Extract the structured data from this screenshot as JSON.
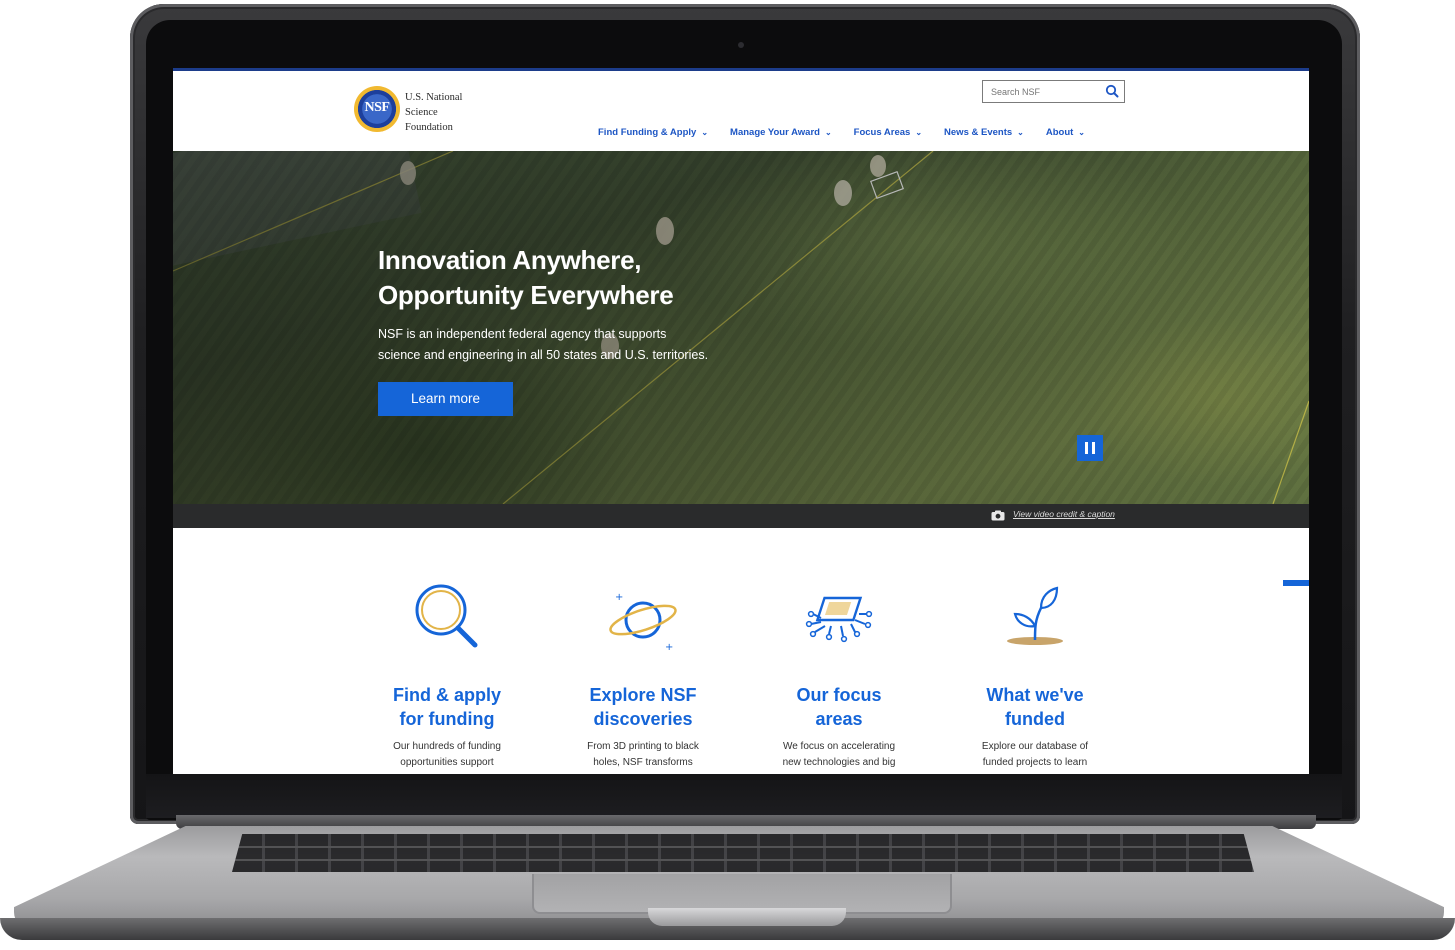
{
  "header": {
    "logo_text_line1": "U.S. National",
    "logo_text_line2": "Science",
    "logo_text_line3": "Foundation",
    "logo_seal_text": "NSF",
    "search_placeholder": "Search NSF"
  },
  "nav": {
    "items": [
      {
        "label": "Find Funding & Apply"
      },
      {
        "label": "Manage Your Award"
      },
      {
        "label": "Focus Areas"
      },
      {
        "label": "News & Events"
      },
      {
        "label": "About"
      }
    ]
  },
  "hero": {
    "title_line1": "Innovation Anywhere,",
    "title_line2": "Opportunity Everywhere",
    "subtitle_line1": "NSF is an independent federal agency that supports",
    "subtitle_line2": "science and engineering in all 50 states and U.S. territories.",
    "cta_label": "Learn more",
    "caption_link": "View video credit & caption"
  },
  "features": [
    {
      "icon": "magnifying-glass-icon",
      "title_line1": "Find & apply",
      "title_line2": "for funding",
      "desc_line1": "Our hundreds of funding",
      "desc_line2": "opportunities support"
    },
    {
      "icon": "planet-icon",
      "title_line1": "Explore NSF",
      "title_line2": "discoveries",
      "desc_line1": "From 3D printing to black",
      "desc_line2": "holes, NSF transforms"
    },
    {
      "icon": "microchip-icon",
      "title_line1": "Our focus",
      "title_line2": "areas",
      "desc_line1": "We focus on accelerating",
      "desc_line2": "new technologies and big"
    },
    {
      "icon": "sprout-icon",
      "title_line1": "What we've",
      "title_line2": "funded",
      "desc_line1": "Explore our database of",
      "desc_line2": "funded projects to learn"
    }
  ],
  "colors": {
    "brand_blue": "#1565d8",
    "nav_blue": "#1d56c4",
    "gold": "#e2b448"
  }
}
